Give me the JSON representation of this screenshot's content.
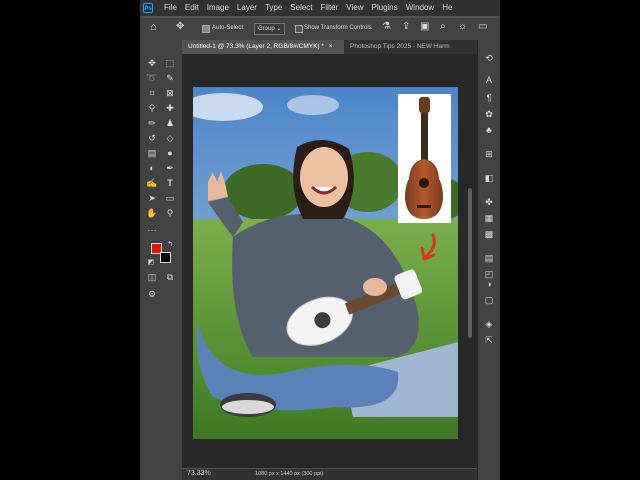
{
  "menu": {
    "logo": "Ps",
    "items": [
      "File",
      "Edit",
      "Image",
      "Layer",
      "Type",
      "Select",
      "Filter",
      "View",
      "Plugins",
      "Window",
      "He"
    ]
  },
  "options": {
    "auto_select_label": "Auto-Select:",
    "group_value": "Group",
    "show_transform_label": "Show Transform Controls"
  },
  "tabs": [
    {
      "label": "Untitled-1 @ 73.3% (Layer 2, RGB/8#/CMYK) *"
    },
    {
      "label": "Photoshop Tips 2025 - NEW Harm"
    }
  ],
  "status": {
    "zoom": "73.33%",
    "dimensions": "1080 px x 1440 px (300 ppi)"
  },
  "colors": {
    "foreground": "#e8100c",
    "background": "#000000",
    "accent": "#31a8ff",
    "arrow": "#e1341e"
  },
  "icons": {
    "left_tools": [
      "move-icon",
      "marquee-icon",
      "lasso-icon",
      "magic-wand-icon",
      "crop-icon",
      "frame-icon",
      "eyedropper-icon",
      "healing-icon",
      "brush-icon",
      "stamp-icon",
      "history-brush-icon",
      "eraser-icon",
      "gradient-icon",
      "blur-icon",
      "dodge-icon",
      "pen-icon",
      "type-icon",
      "path-select-icon",
      "rectangle-icon",
      "hand-icon",
      "zoom-icon",
      "more-tools-icon"
    ],
    "right_panels": [
      "history-icon",
      "character-icon",
      "paragraph-icon",
      "brushes-icon",
      "properties-icon",
      "adjustments-icon",
      "swatches-icon",
      "layers-icon",
      "channels-icon",
      "paths-icon"
    ]
  }
}
